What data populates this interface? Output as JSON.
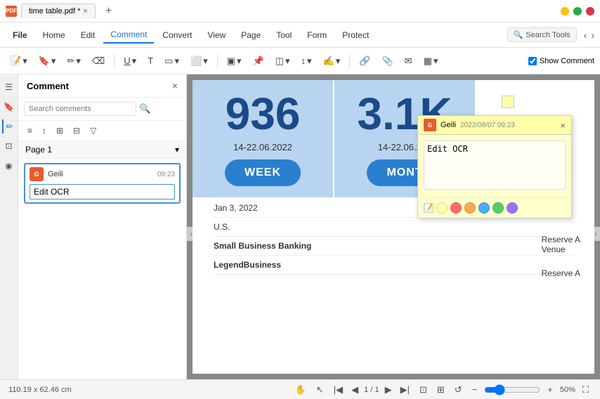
{
  "titleBar": {
    "appIcon": "PDF",
    "fileName": "time table.pdf *",
    "closeTab": "×",
    "addTab": "+",
    "winMin": "−",
    "winMax": "□",
    "winClose": "×"
  },
  "menuBar": {
    "items": [
      {
        "label": "File",
        "id": "file"
      },
      {
        "label": "Home",
        "id": "home"
      },
      {
        "label": "Edit",
        "id": "edit"
      },
      {
        "label": "Comment",
        "id": "comment",
        "active": true
      },
      {
        "label": "Convert",
        "id": "convert"
      },
      {
        "label": "View",
        "id": "view"
      },
      {
        "label": "Page",
        "id": "page"
      },
      {
        "label": "Tool",
        "id": "tool"
      },
      {
        "label": "Form",
        "id": "form"
      },
      {
        "label": "Protect",
        "id": "protect"
      }
    ],
    "searchTools": "Search Tools"
  },
  "toolbar": {
    "tools": [
      {
        "icon": "≡▾",
        "name": "note-tool"
      },
      {
        "icon": "🔖▾",
        "name": "bookmark-tool"
      },
      {
        "icon": "✏▾",
        "name": "draw-tool"
      },
      {
        "icon": "⌫",
        "name": "erase-tool"
      },
      {
        "icon": "U̲▾",
        "name": "underline-tool"
      },
      {
        "icon": "T",
        "name": "text-tool"
      },
      {
        "icon": "⬛▾",
        "name": "rect-tool"
      },
      {
        "icon": "⬛▾",
        "name": "shape-tool"
      },
      {
        "icon": "▭▾",
        "name": "box-tool"
      },
      {
        "icon": "📌",
        "name": "sticky-tool"
      },
      {
        "icon": "◫▾",
        "name": "stamp-tool"
      },
      {
        "icon": "↕▾",
        "name": "measure-tool"
      },
      {
        "icon": "✍▾",
        "name": "sign-tool"
      },
      {
        "icon": "🔗",
        "name": "link-tool"
      },
      {
        "icon": "📎",
        "name": "attach-tool"
      },
      {
        "icon": "✉",
        "name": "email-tool"
      },
      {
        "icon": "▣▾",
        "name": "area-tool"
      }
    ],
    "showComment": "Show Comment",
    "showCommentChecked": true
  },
  "sidebar": {
    "title": "Comment",
    "closeBtn": "×",
    "searchPlaceholder": "Search comments",
    "toolBtns": [
      "≡",
      "↕",
      "⊞",
      "⊟",
      "▽"
    ],
    "sections": [
      {
        "label": "Page 1",
        "expanded": true,
        "comments": [
          {
            "user": "Geili",
            "avatar": "G",
            "time": "09:23",
            "text": "Edit OCR",
            "editing": true
          }
        ]
      }
    ]
  },
  "pdfContent": {
    "stats": [
      {
        "number": "936",
        "date": "14-22.06.2022",
        "btnLabel": "WEEK"
      },
      {
        "number": "3.1K",
        "date": "14-22.06.202",
        "btnLabel": "MONT"
      }
    ],
    "tableRows": [
      {
        "cell": "Jan 3, 2022"
      },
      {
        "cell": "U.S."
      },
      {
        "cell": "Small Business Banking",
        "bold": true
      },
      {
        "cell": "LegendBusiness",
        "bold": true
      },
      {
        "cell": "Reserve A Venue",
        "right": true
      },
      {
        "cell": "Reserve A",
        "right": true
      }
    ]
  },
  "stickyNote": {
    "user": "Geili",
    "avatar": "G",
    "datetime": "2022/08/07 09:23",
    "text": "Edit OCR",
    "closeBtn": "×",
    "colors": [
      {
        "color": "#ffffaa",
        "name": "yellow"
      },
      {
        "color": "#ff6b6b",
        "name": "red"
      },
      {
        "color": "#ffa94d",
        "name": "orange"
      },
      {
        "color": "#4dabf7",
        "name": "blue"
      },
      {
        "color": "#51cf66",
        "name": "green"
      },
      {
        "color": "#9775fa",
        "name": "purple"
      }
    ]
  },
  "statusBar": {
    "dimensions": "110.19 x 62.46 cm",
    "currentPage": "1",
    "totalPages": "1",
    "zoomLevel": "50%"
  },
  "sidebarIcons": [
    {
      "icon": "☰",
      "name": "panel-icon",
      "active": false
    },
    {
      "icon": "🔖",
      "name": "bookmark-icon",
      "active": false
    },
    {
      "icon": "✏",
      "name": "annotate-icon",
      "active": true
    },
    {
      "icon": "⊡",
      "name": "layers-icon",
      "active": false
    },
    {
      "icon": "◉",
      "name": "ocr-icon",
      "active": false
    }
  ]
}
